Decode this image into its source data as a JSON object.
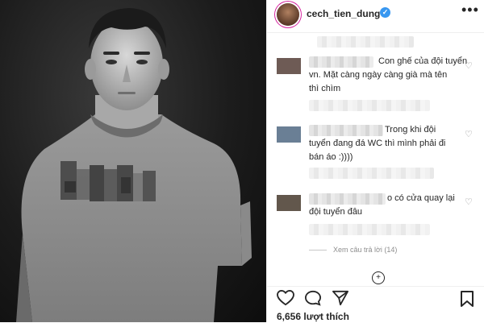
{
  "post": {
    "username": "cech_tien_dung",
    "verified_icon": "verified-badge-icon",
    "more_label": "•••"
  },
  "comments": [
    {
      "avatar_color": "#6e5b55",
      "text_line1": "Con ghế của đội tuyển",
      "text_line2": "vn. Mặt càng ngày càng già mà tên",
      "text_line3": "thì chìm"
    },
    {
      "avatar_color": "#6a7f95",
      "text_line1": "Trong khi đội",
      "text_line2": "tuyển đang đá WC thì mình phải đi",
      "text_line3": "bán áo :))))"
    },
    {
      "avatar_color": "#62574c",
      "text_line1": "o có cửa quay lại",
      "text_line2": "đội tuyển đâu"
    }
  ],
  "view_replies": "Xem câu trả lời (14)",
  "load_more": "+",
  "actions": {
    "like_icon": "heart-icon",
    "comment_icon": "comment-icon",
    "share_icon": "share-icon",
    "save_icon": "bookmark-icon"
  },
  "likes_text": "6,656 lượt thích"
}
